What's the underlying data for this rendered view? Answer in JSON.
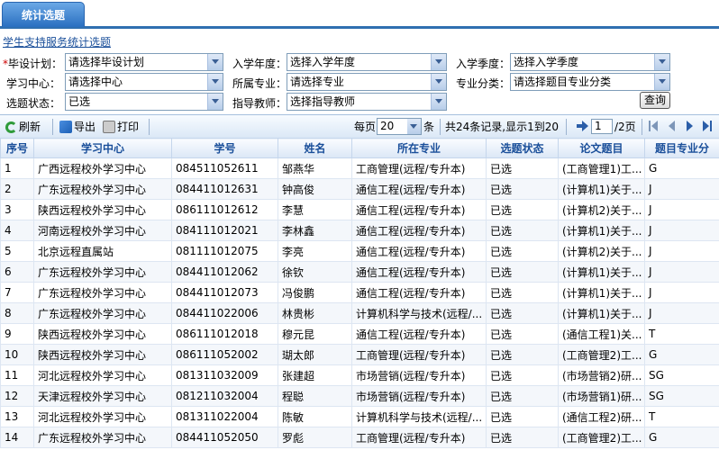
{
  "tab": {
    "label": "统计选题"
  },
  "breadcrumb": "学生支持服务统计选题",
  "filters": {
    "plan_label": "毕设计划：",
    "plan_value": "请选择毕设计划",
    "year_label": "入学年度：",
    "year_value": "选择入学年度",
    "season_label": "入学季度：",
    "season_value": "选择入学季度",
    "center_label": "学习中心：",
    "center_value": "请选择中心",
    "major_label": "所属专业：",
    "major_value": "请选择专业",
    "category_label": "专业分类：",
    "category_value": "请选择题目专业分类",
    "status_label": "选题状态：",
    "status_value": "已选",
    "teacher_label": "指导教师：",
    "teacher_value": "选择指导教师",
    "query_label": "查询"
  },
  "toolbar": {
    "refresh": "刷新",
    "export": "导出",
    "print": "打印",
    "per_page_label": "每页",
    "per_page_value": "20",
    "per_page_unit": "条",
    "summary": "共24条记录,显示1到20",
    "page_value": "1",
    "page_total": "/2页"
  },
  "table": {
    "headers": [
      "序号",
      "学习中心",
      "学号",
      "姓名",
      "所在专业",
      "选题状态",
      "论文题目",
      "题目专业分"
    ],
    "rows": [
      [
        "1",
        "广西远程校外学习中心",
        "084511052611",
        "邹燕华",
        "工商管理(远程/专升本)",
        "已选",
        "(工商管理1)工...",
        "G"
      ],
      [
        "2",
        "广东远程校外学习中心",
        "084411012631",
        "钟高俊",
        "通信工程(远程/专升本)",
        "已选",
        "(计算机1)关于...",
        "J"
      ],
      [
        "3",
        "陕西远程校外学习中心",
        "086111012612",
        "李慧",
        "通信工程(远程/专升本)",
        "已选",
        "(计算机2)关于...",
        "J"
      ],
      [
        "4",
        "河南远程校外学习中心",
        "084111012021",
        "李林鑫",
        "通信工程(远程/专升本)",
        "已选",
        "(计算机1)关于...",
        "J"
      ],
      [
        "5",
        "北京远程直属站",
        "081111012075",
        "李亮",
        "通信工程(远程/专升本)",
        "已选",
        "(计算机2)关于...",
        "J"
      ],
      [
        "6",
        "广东远程校外学习中心",
        "084411012062",
        "徐钦",
        "通信工程(远程/专升本)",
        "已选",
        "(计算机1)关于...",
        "J"
      ],
      [
        "7",
        "广东远程校外学习中心",
        "084411012073",
        "冯俊鹏",
        "通信工程(远程/专升本)",
        "已选",
        "(计算机1)关于...",
        "J"
      ],
      [
        "8",
        "广东远程校外学习中心",
        "084411022006",
        "林贵彬",
        "计算机科学与技术(远程/...",
        "已选",
        "(计算机1)关于...",
        "J"
      ],
      [
        "9",
        "陕西远程校外学习中心",
        "086111012018",
        "穆元昆",
        "通信工程(远程/专升本)",
        "已选",
        "(通信工程1)关...",
        "T"
      ],
      [
        "10",
        "陕西远程校外学习中心",
        "086111052002",
        "瑚太郎",
        "工商管理(远程/专升本)",
        "已选",
        "(工商管理2)工...",
        "G"
      ],
      [
        "11",
        "河北远程校外学习中心",
        "081311032009",
        "张建超",
        "市场营销(远程/专升本)",
        "已选",
        "(市场营销2)研...",
        "SG"
      ],
      [
        "12",
        "天津远程校外学习中心",
        "081211032004",
        "程聪",
        "市场营销(远程/专升本)",
        "已选",
        "(市场营销1)研...",
        "SG"
      ],
      [
        "13",
        "河北远程校外学习中心",
        "081311022004",
        "陈敏",
        "计算机科学与技术(远程/...",
        "已选",
        "(通信工程2)研...",
        "T"
      ],
      [
        "14",
        "广东远程校外学习中心",
        "084411052050",
        "罗彪",
        "工商管理(远程/专升本)",
        "已选",
        "(工商管理2)工...",
        "G"
      ]
    ]
  }
}
